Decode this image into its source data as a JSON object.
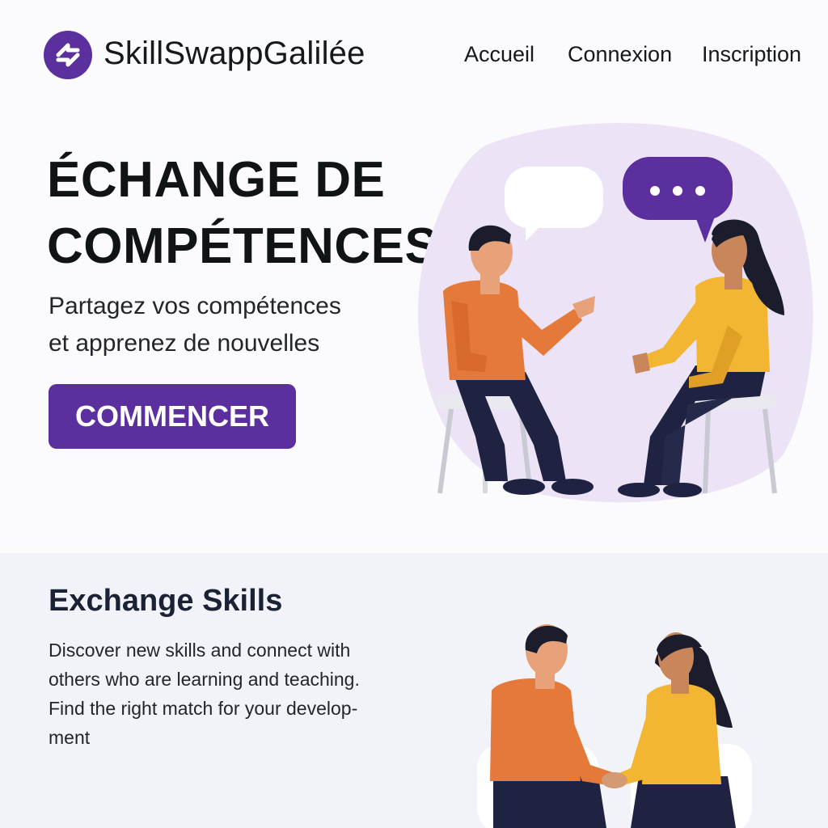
{
  "header": {
    "brand": "SkillSwappGalilée",
    "logo_icon": "swap-arrows-icon",
    "nav": [
      "Accueil",
      "Connexion",
      "Inscription"
    ]
  },
  "hero": {
    "title_line1": "ÉCHANGE DE",
    "title_line2": "COMPÉTENCES",
    "subtitle_line1": "Partagez vos compétences",
    "subtitle_line2": "et apprenez de nouvelles",
    "cta_label": "COMMENCER",
    "illustration": "two-people-conversation-illustration"
  },
  "section2": {
    "title": "Exchange Skills",
    "text_lines": [
      "Discover new skills and connect with",
      "others who are learning and teaching.",
      "Find the right match for your develop-",
      "ment"
    ],
    "illustration": "two-people-holding-hands-illustration"
  },
  "colors": {
    "brand_purple": "#5b2f9e",
    "orange_shirt": "#e5793a",
    "yellow_shirt": "#f2b632",
    "lavender_bg": "#ece3f6",
    "section_bg": "#f1f3f9"
  }
}
